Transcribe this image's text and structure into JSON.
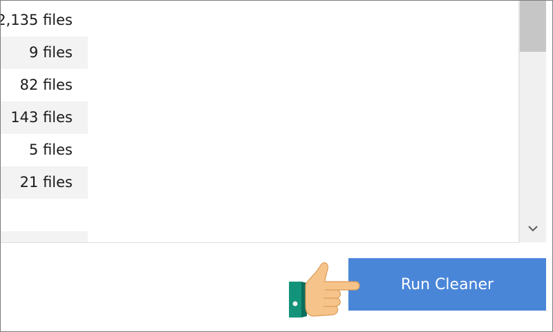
{
  "results": {
    "rows": [
      {
        "count": "2,135 files"
      },
      {
        "count": "9 files"
      },
      {
        "count": "82 files"
      },
      {
        "count": "143 files"
      },
      {
        "count": "5 files"
      },
      {
        "count": "21 files"
      },
      {
        "count": ""
      }
    ]
  },
  "actions": {
    "run_cleaner_label": "Run Cleaner",
    "pointer_icon": "pointing-hand-icon",
    "accent_color": "#4a86d8"
  },
  "scrollbar": {
    "down_icon": "chevron-down-icon"
  }
}
